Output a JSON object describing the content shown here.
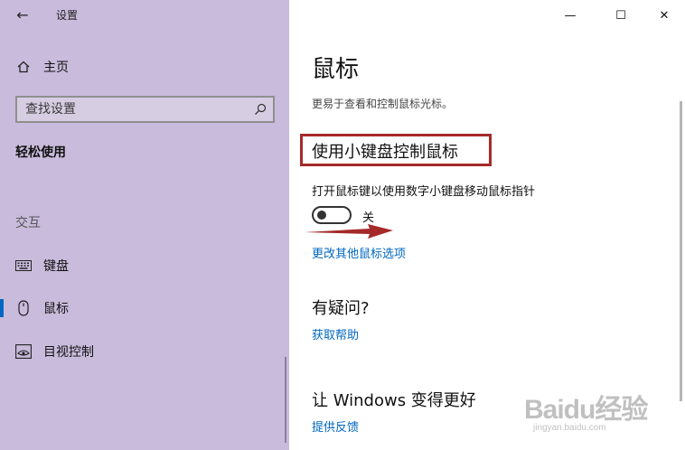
{
  "window": {
    "title": "设置",
    "buttons": {
      "minimize": "—",
      "maximize": "☐",
      "close": "✕"
    }
  },
  "sidebar": {
    "home_label": "主页",
    "search": {
      "value": "",
      "placeholder": "查找设置"
    },
    "category": "轻松使用",
    "group_header": "交互",
    "items": [
      {
        "label": "键盘",
        "icon": "keyboard-icon",
        "active": false
      },
      {
        "label": "鼠标",
        "icon": "mouse-icon",
        "active": true
      },
      {
        "label": "目视控制",
        "icon": "eye-control-icon",
        "active": false
      }
    ]
  },
  "main": {
    "title": "鼠标",
    "subtitle": "更易于查看和控制鼠标光标。",
    "section_title": "使用小键盘控制鼠标",
    "setting_desc": "打开鼠标键以使用数字小键盘移动鼠标指针",
    "toggle": {
      "state_label": "关",
      "on": false
    },
    "link_more_mouse": "更改其他鼠标选项",
    "question_title": "有疑问?",
    "link_help": "获取帮助",
    "improve_title": "让 Windows 变得更好",
    "link_feedback": "提供反馈"
  },
  "watermark": {
    "logo": "Baidu经验",
    "url": "jingyan.baidu.com"
  },
  "colors": {
    "sidebar_bg": "#c9bbdc",
    "accent": "#0067c0",
    "highlight": "#a52a2a"
  }
}
